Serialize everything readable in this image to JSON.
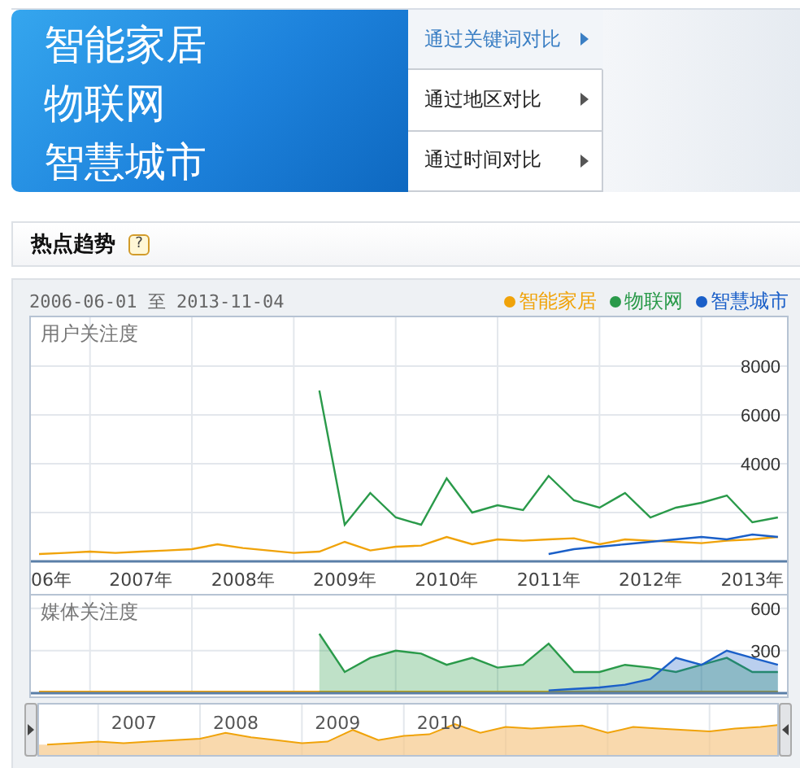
{
  "header": {
    "keywords": [
      "智能家居",
      "物联网",
      "智慧城市"
    ]
  },
  "compare_menu": [
    {
      "label": "通过关键词对比",
      "selected": true
    },
    {
      "label": "通过地区对比",
      "selected": false
    },
    {
      "label": "通过时间对比",
      "selected": false
    }
  ],
  "trend_panel": {
    "title": "热点趋势",
    "help": "?"
  },
  "date_range": "2006-06-01 至 2013-11-04",
  "user_chart": {
    "label": "用户关注度",
    "cut_axis_label": "06年",
    "chart_data": {
      "type": "line",
      "grid": true,
      "xlim": [
        2006.42,
        2013.84
      ],
      "ylim": [
        0,
        10000
      ],
      "xticks": [
        {
          "value": 2007.5,
          "label": "2007年"
        },
        {
          "value": 2008.5,
          "label": "2008年"
        },
        {
          "value": 2009.5,
          "label": "2009年"
        },
        {
          "value": 2010.5,
          "label": "2010年"
        },
        {
          "value": 2011.5,
          "label": "2011年"
        },
        {
          "value": 2012.5,
          "label": "2012年"
        },
        {
          "value": 2013.5,
          "label": "2013年"
        }
      ],
      "yticks": [
        4000,
        6000,
        8000
      ],
      "x": [
        2006.5,
        2006.75,
        2007,
        2007.25,
        2007.5,
        2007.75,
        2008,
        2008.25,
        2008.5,
        2008.75,
        2009,
        2009.25,
        2009.5,
        2009.75,
        2010,
        2010.25,
        2010.5,
        2010.75,
        2011,
        2011.25,
        2011.5,
        2011.75,
        2012,
        2012.25,
        2012.5,
        2012.75,
        2013,
        2013.25,
        2013.5,
        2013.75
      ],
      "series": [
        {
          "name": "智能家居",
          "color": "#f0a30a",
          "values": [
            300,
            350,
            400,
            350,
            400,
            450,
            500,
            700,
            550,
            450,
            350,
            400,
            800,
            450,
            600,
            650,
            1000,
            700,
            900,
            850,
            900,
            950,
            700,
            900,
            850,
            800,
            750,
            850,
            900,
            1000
          ]
        },
        {
          "name": "物联网",
          "color": "#2a9a4a",
          "values": [
            null,
            null,
            null,
            null,
            null,
            null,
            null,
            null,
            null,
            null,
            null,
            7000,
            1500,
            2800,
            1800,
            1500,
            3400,
            2000,
            2300,
            2100,
            3500,
            2500,
            2200,
            2800,
            1800,
            2200,
            2400,
            2700,
            1600,
            1800
          ]
        },
        {
          "name": "智慧城市",
          "color": "#1a5fc8",
          "values": [
            null,
            null,
            null,
            null,
            null,
            null,
            null,
            null,
            null,
            null,
            null,
            null,
            null,
            null,
            null,
            null,
            null,
            null,
            null,
            null,
            300,
            500,
            600,
            700,
            800,
            900,
            1000,
            900,
            1100,
            1000
          ]
        }
      ]
    }
  },
  "media_chart": {
    "label": "媒体关注度",
    "chart_data": {
      "type": "area",
      "grid": true,
      "xlim": [
        2006.42,
        2013.84
      ],
      "ylim": [
        0,
        690
      ],
      "yticks": [
        300,
        600
      ],
      "x": [
        2006.5,
        2006.75,
        2007,
        2007.25,
        2007.5,
        2007.75,
        2008,
        2008.25,
        2008.5,
        2008.75,
        2009,
        2009.25,
        2009.5,
        2009.75,
        2010,
        2010.25,
        2010.5,
        2010.75,
        2011,
        2011.25,
        2011.5,
        2011.75,
        2012,
        2012.25,
        2012.5,
        2012.75,
        2013,
        2013.25,
        2013.5,
        2013.75
      ],
      "series": [
        {
          "color": "#f0a30a",
          "values": [
            10,
            10,
            10,
            10,
            10,
            10,
            10,
            10,
            10,
            10,
            10,
            10,
            10,
            10,
            10,
            10,
            10,
            10,
            10,
            10,
            10,
            10,
            10,
            10,
            10,
            10,
            10,
            10,
            10,
            10
          ]
        },
        {
          "color": "#2a9a4a",
          "values": [
            null,
            null,
            null,
            null,
            null,
            null,
            null,
            null,
            null,
            null,
            null,
            420,
            150,
            250,
            300,
            280,
            200,
            250,
            180,
            200,
            350,
            150,
            150,
            200,
            180,
            150,
            200,
            250,
            150,
            150
          ]
        },
        {
          "color": "#1a5fc8",
          "values": [
            null,
            null,
            null,
            null,
            null,
            null,
            null,
            null,
            null,
            null,
            null,
            null,
            null,
            null,
            null,
            null,
            null,
            null,
            null,
            null,
            20,
            30,
            40,
            60,
            100,
            250,
            200,
            300,
            250,
            200
          ]
        }
      ]
    }
  },
  "navigator": {
    "year_labels": [
      "2007",
      "2008",
      "2009",
      "2010"
    ]
  }
}
